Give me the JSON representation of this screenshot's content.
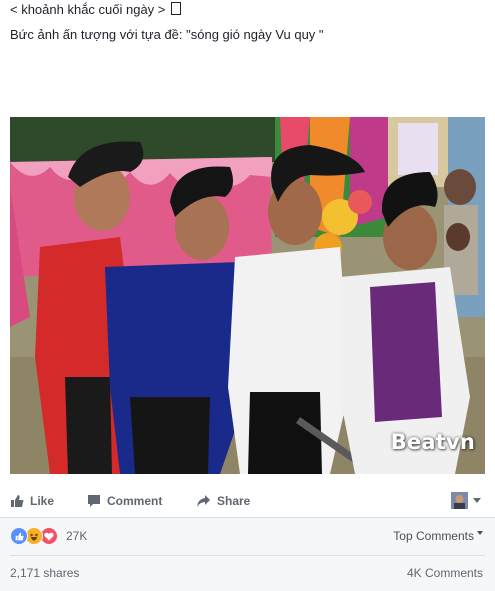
{
  "post": {
    "breadcrumb": "< khoảnh khắc cuối ngày >",
    "caption": "Bức ảnh ấn tượng với tựa đề: \"sóng gió ngày Vu quy \"",
    "photo": {
      "watermark": "Beatvn"
    }
  },
  "actions": {
    "like": "Like",
    "comment": "Comment",
    "share": "Share"
  },
  "reactions": {
    "icons": [
      "like-reaction",
      "haha-reaction",
      "love-reaction"
    ],
    "count": "27K",
    "sort_label": "Top Comments"
  },
  "stats": {
    "shares": "2,171 shares",
    "comments": "4K Comments"
  },
  "colors": {
    "like_blue": "#5890ff",
    "love_red": "#f25268",
    "haha_yellow": "#f7b125",
    "muted_text": "#606770"
  }
}
